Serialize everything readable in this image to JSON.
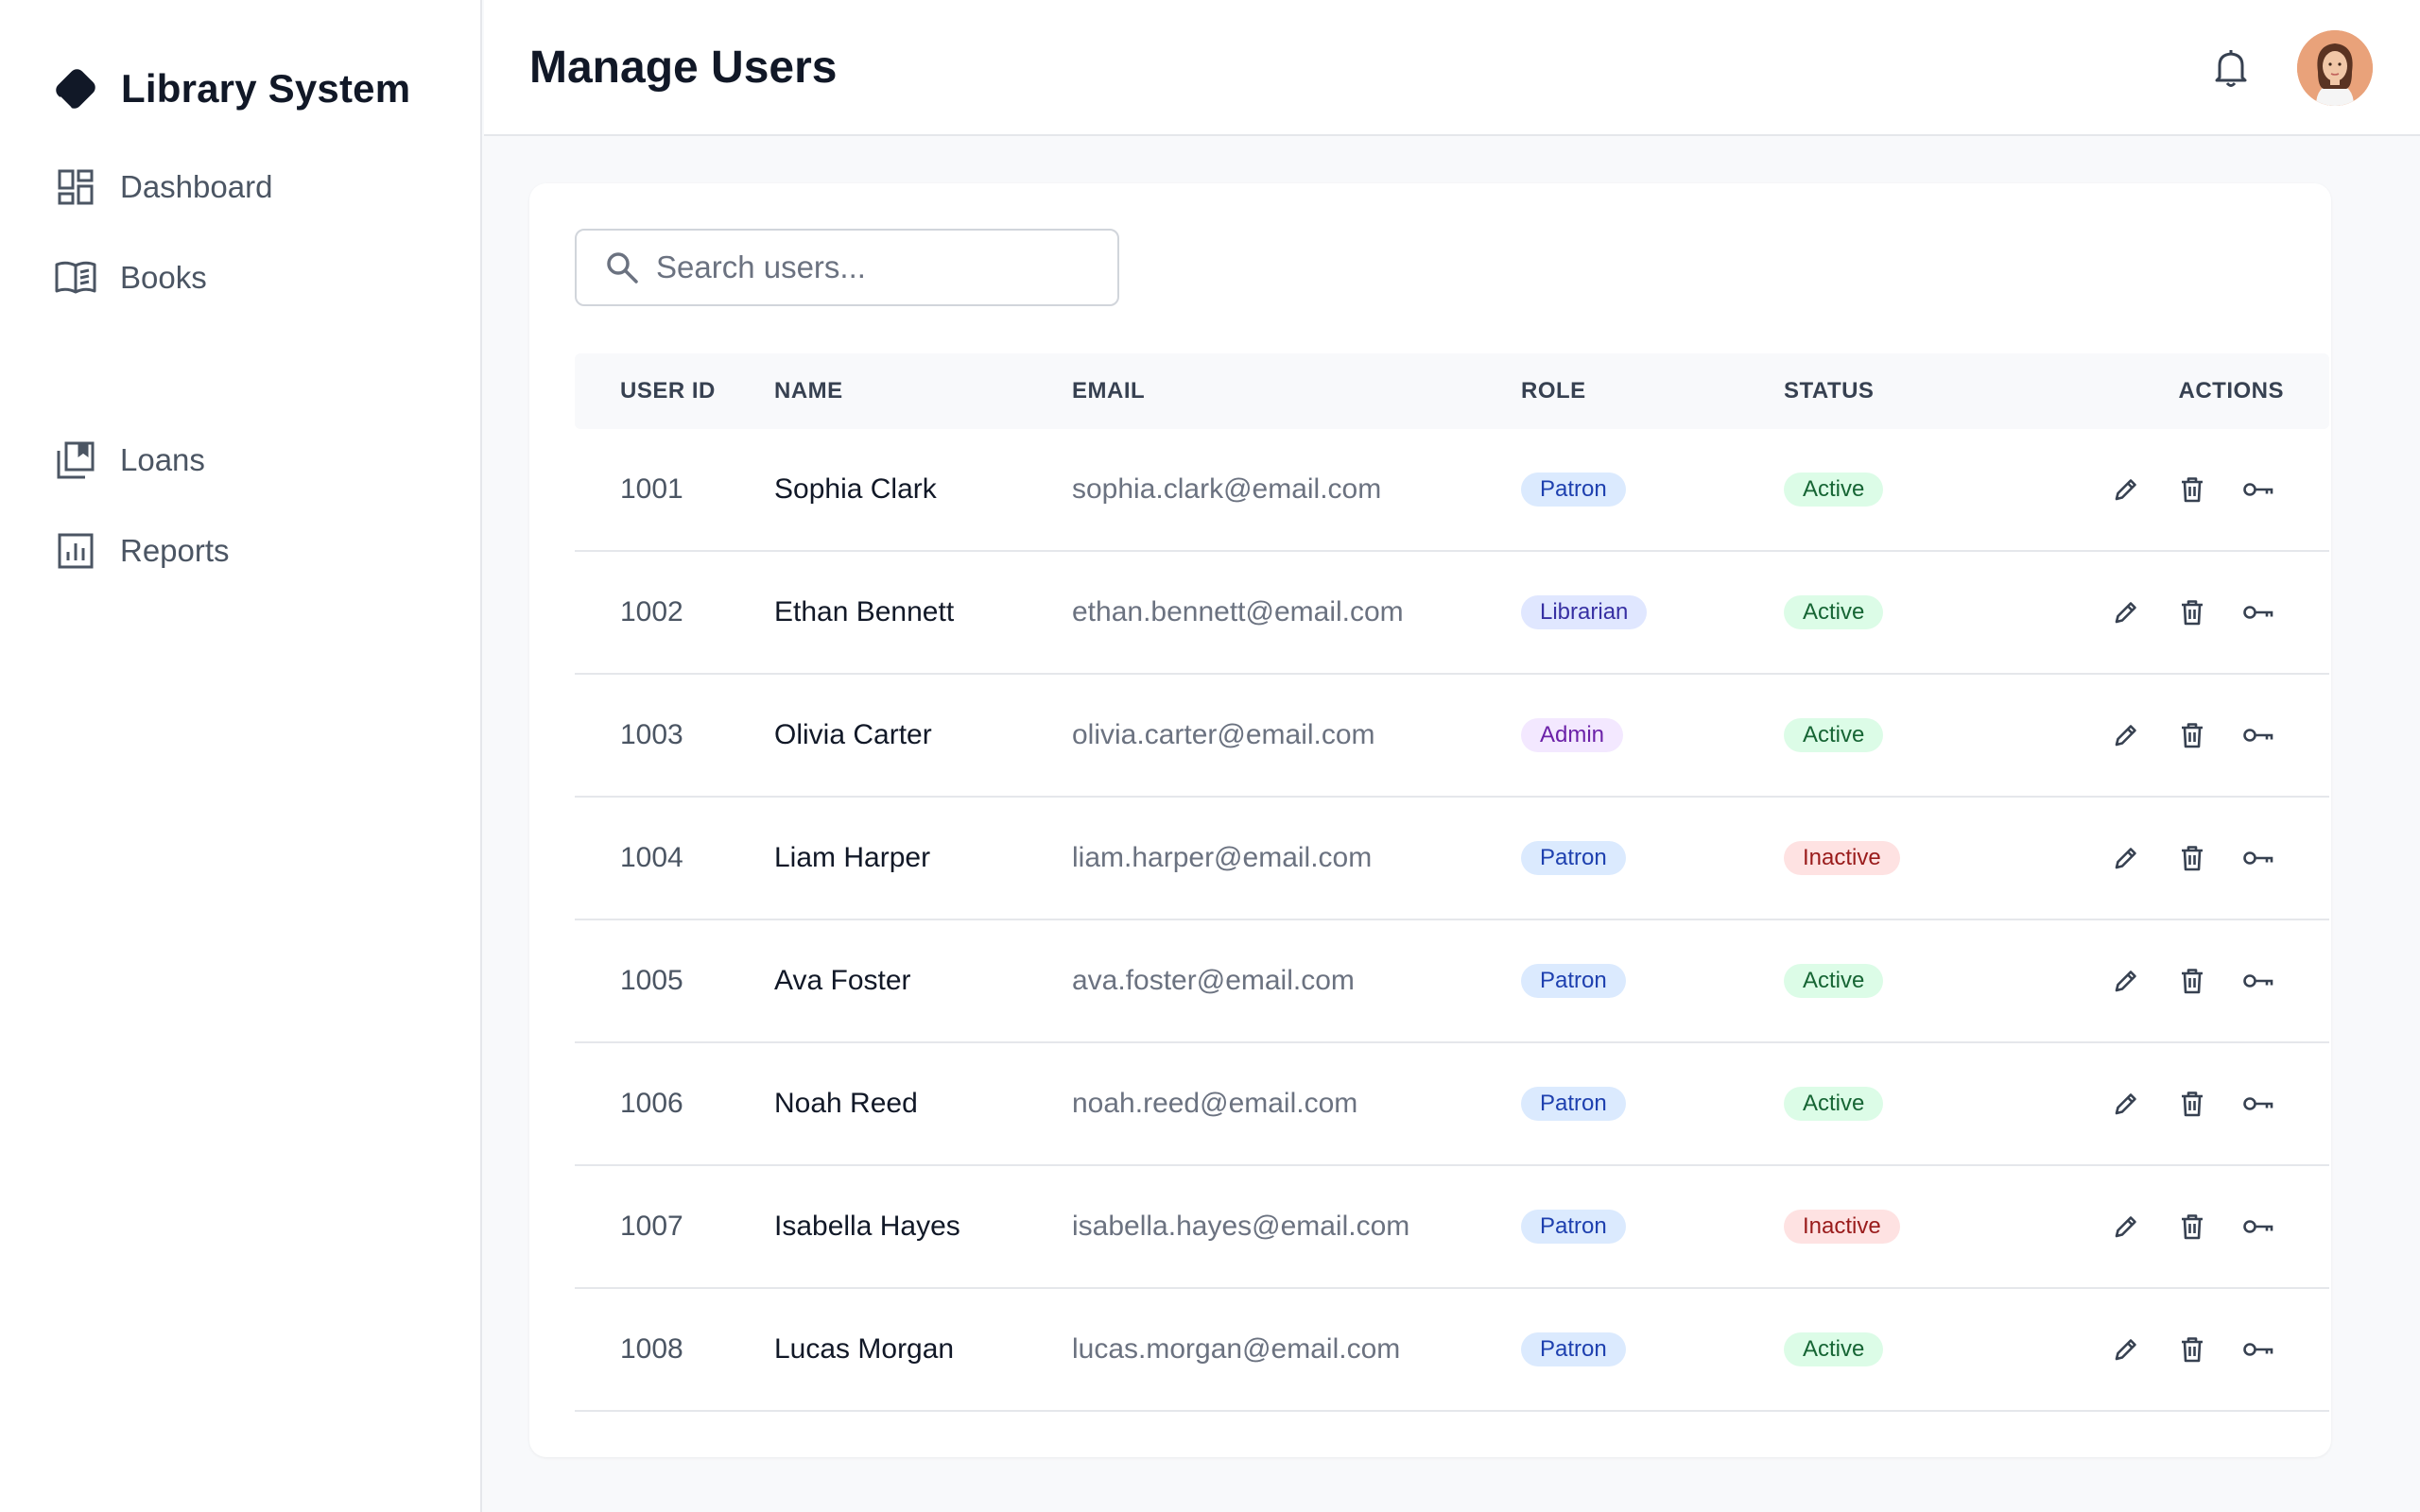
{
  "app": {
    "title": "Library System",
    "logo_icon": "book-icon"
  },
  "sidebar": {
    "items": [
      {
        "label": "Dashboard",
        "icon": "dashboard-icon"
      },
      {
        "label": "Books",
        "icon": "open-book-icon"
      },
      {
        "label": "Loans",
        "icon": "library-loans-icon"
      },
      {
        "label": "Reports",
        "icon": "bar-chart-icon"
      }
    ]
  },
  "header": {
    "title": "Manage Users",
    "notification_icon": "bell-icon",
    "avatar_icon": "user-avatar"
  },
  "search": {
    "placeholder": "Search users...",
    "value": ""
  },
  "table": {
    "columns": [
      "USER ID",
      "NAME",
      "EMAIL",
      "ROLE",
      "STATUS",
      "ACTIONS"
    ],
    "action_icons": [
      "edit-icon",
      "delete-icon",
      "key-icon"
    ],
    "rows": [
      {
        "id": "1001",
        "name": "Sophia Clark",
        "email": "sophia.clark@email.com",
        "role": "Patron",
        "status": "Active"
      },
      {
        "id": "1002",
        "name": "Ethan Bennett",
        "email": "ethan.bennett@email.com",
        "role": "Librarian",
        "status": "Active"
      },
      {
        "id": "1003",
        "name": "Olivia Carter",
        "email": "olivia.carter@email.com",
        "role": "Admin",
        "status": "Active"
      },
      {
        "id": "1004",
        "name": "Liam Harper",
        "email": "liam.harper@email.com",
        "role": "Patron",
        "status": "Inactive"
      },
      {
        "id": "1005",
        "name": "Ava Foster",
        "email": "ava.foster@email.com",
        "role": "Patron",
        "status": "Active"
      },
      {
        "id": "1006",
        "name": "Noah Reed",
        "email": "noah.reed@email.com",
        "role": "Patron",
        "status": "Active"
      },
      {
        "id": "1007",
        "name": "Isabella Hayes",
        "email": "isabella.hayes@email.com",
        "role": "Patron",
        "status": "Inactive"
      },
      {
        "id": "1008",
        "name": "Lucas Morgan",
        "email": "lucas.morgan@email.com",
        "role": "Patron",
        "status": "Active"
      }
    ]
  },
  "colors": {
    "role_patron": "#dbeafe",
    "role_librarian": "#e0e7ff",
    "role_admin": "#f3e8ff",
    "status_active": "#dcfce7",
    "status_inactive": "#fee2e2"
  }
}
